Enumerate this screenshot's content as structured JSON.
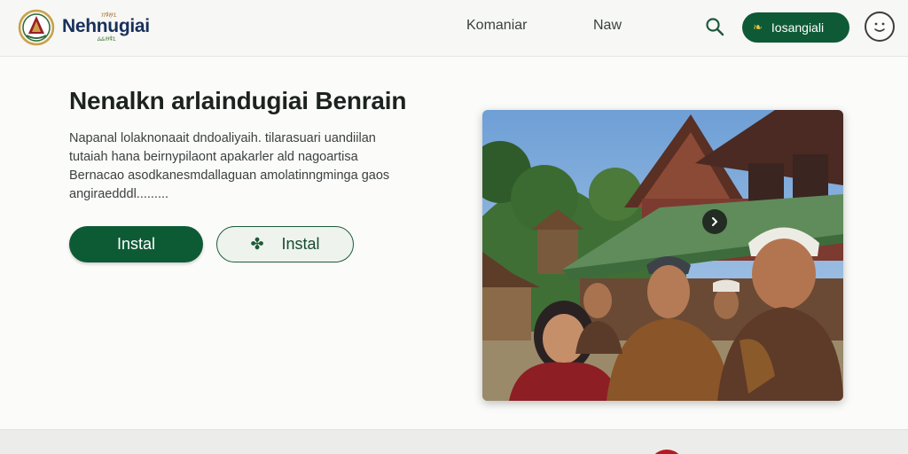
{
  "header": {
    "brand_name": "Nehnugiai",
    "brand_tag": "ᮊᮛᮤᮞᮥᮔ",
    "brand_sub": "ᮓᮓᮞᮛᮤᮔ",
    "nav": [
      "Komaniar",
      "Naw"
    ],
    "cta_label": "Iosangiali",
    "icons": [
      "logo-emblem",
      "search-icon",
      "leaf-icon",
      "smiley-face-icon"
    ]
  },
  "hero": {
    "title": "Nenalkn arlaindugiai Benrain",
    "description_lines": [
      "Napanal lolaknonaait dndoaliyaih. tilarasuari uandiilan",
      "tutaiah hana beirnypilaont apakarler ald nagoartisa",
      "Bernacao asodkanesmdallaguan amolatinngminga gaos",
      "angiraedddl........."
    ],
    "primary_button": "Instal",
    "secondary_button": "Instal"
  },
  "colors": {
    "primary_green": "#0d5b35",
    "brand_navy": "#18305a",
    "accent_gold": "#f2c53d",
    "accent_red": "#b51a22"
  }
}
